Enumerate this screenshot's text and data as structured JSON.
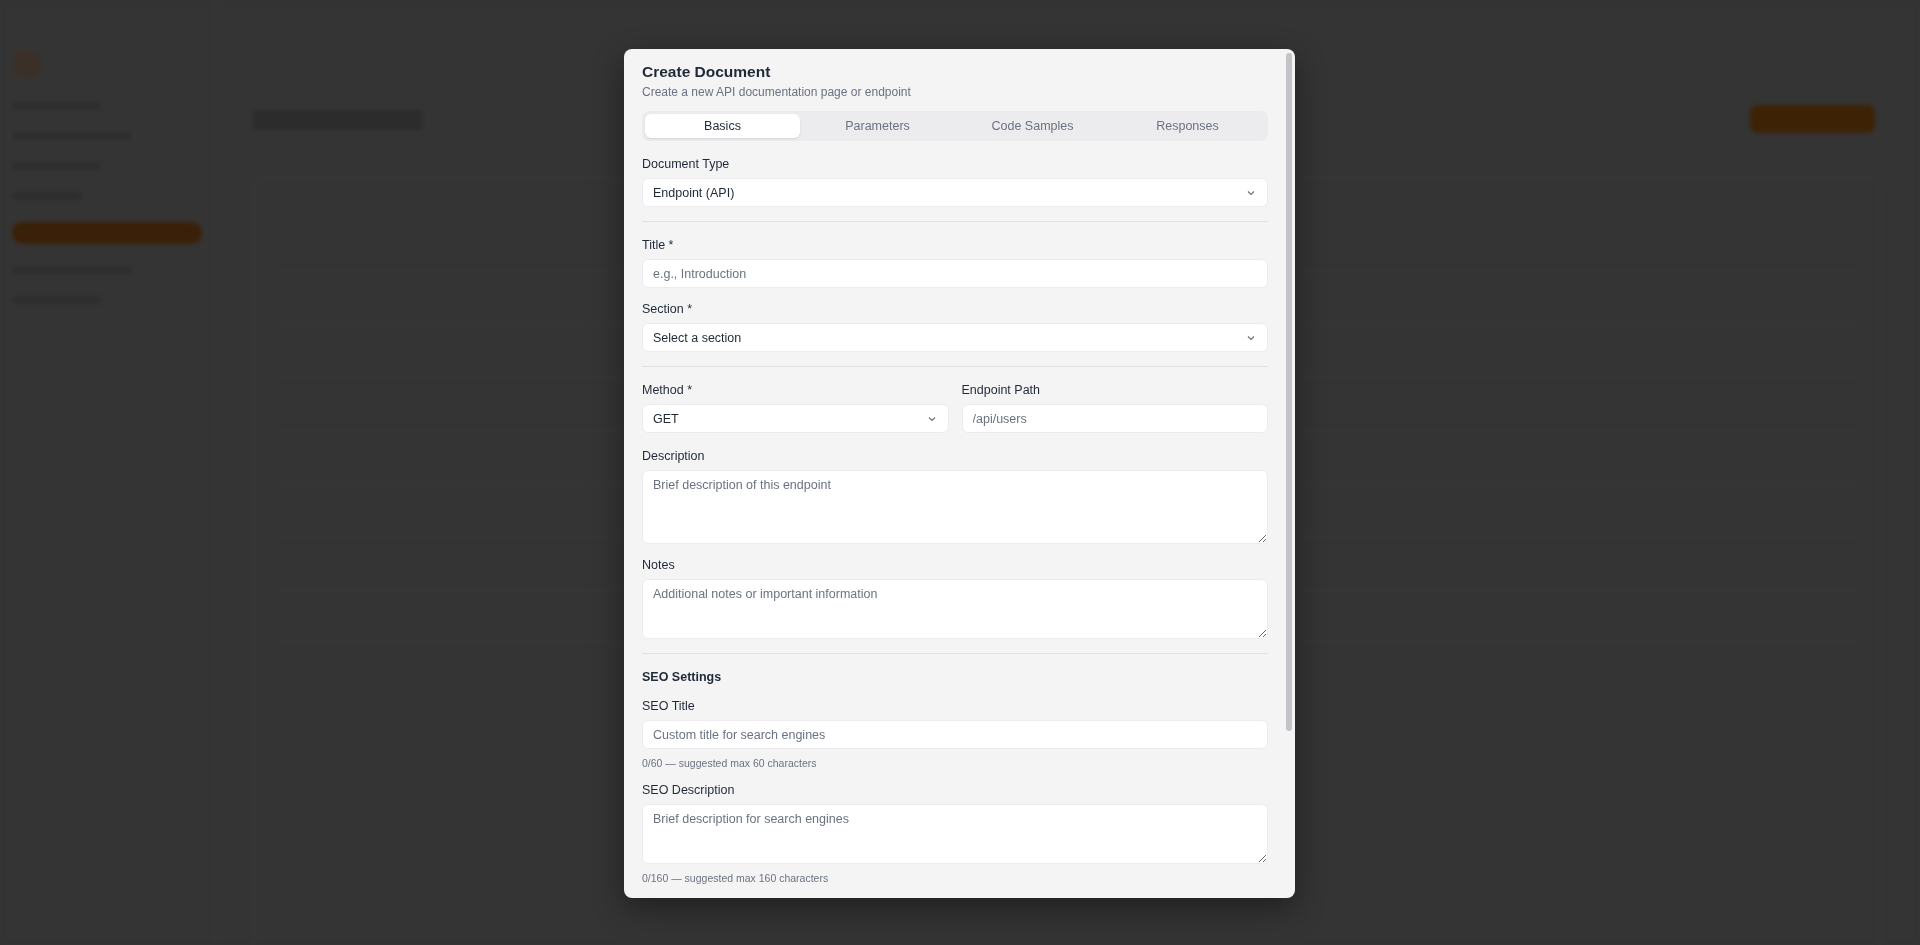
{
  "dialog": {
    "title": "Create Document",
    "subtitle": "Create a new API documentation page or endpoint",
    "tabs": [
      {
        "label": "Basics",
        "selected": true
      },
      {
        "label": "Parameters",
        "selected": false
      },
      {
        "label": "Code Samples",
        "selected": false
      },
      {
        "label": "Responses",
        "selected": false
      }
    ],
    "sections": [
      {
        "fields": [
          {
            "kind": "select",
            "label": "Document Type",
            "value": "Endpoint (API)"
          }
        ]
      },
      {
        "fields": [
          {
            "kind": "input",
            "label": "Title *",
            "placeholder": "e.g., Introduction"
          },
          {
            "kind": "select",
            "label": "Section *",
            "value": "Select a section"
          }
        ]
      },
      {
        "fields": [
          {
            "kind": "row",
            "fields": [
              {
                "kind": "select",
                "label": "Method *",
                "value": "GET"
              },
              {
                "kind": "input",
                "label": "Endpoint Path",
                "placeholder": "/api/users"
              }
            ]
          },
          {
            "kind": "textarea",
            "label": "Description",
            "placeholder": "Brief description of this endpoint"
          },
          {
            "kind": "textarea",
            "label": "Notes",
            "placeholder": "Additional notes or important information"
          }
        ]
      },
      {
        "heading": "SEO Settings",
        "fields": [
          {
            "kind": "input",
            "label": "SEO Title",
            "placeholder": "Custom title for search engines",
            "hint": "0/60 — suggested max 60 characters"
          },
          {
            "kind": "textarea",
            "label": "SEO Description",
            "placeholder": "Brief description for search engines",
            "hint": "0/160 — suggested max 160 characters"
          }
        ]
      }
    ]
  }
}
